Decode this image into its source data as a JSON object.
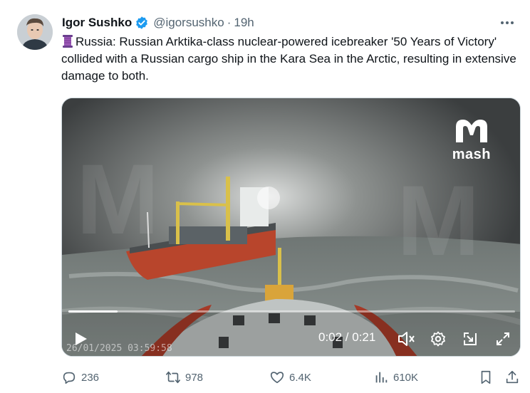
{
  "author": {
    "name": "Igor Sushko",
    "handle": "@igorsushko",
    "separator": "·",
    "time": "19h",
    "verified": true
  },
  "tweet": {
    "text": "Russia: Russian Arktika-class nuclear-powered icebreaker '50 Years of Victory' collided with a Russian cargo ship in the Kara Sea in the Arctic, resulting in extensive damage to both.",
    "leading_emoji": "thread-spool-icon"
  },
  "video": {
    "watermark": "mash",
    "timecode": "0:02 / 0:21",
    "progress": 0.11,
    "overlay_timestamp": "26/01/2025 03:59:58"
  },
  "stats": {
    "replies": "236",
    "reposts": "978",
    "likes": "6.4K",
    "views": "610K"
  },
  "colors": {
    "text_primary": "#0f1419",
    "text_secondary": "#536471",
    "verified_blue": "#1d9bf0"
  }
}
